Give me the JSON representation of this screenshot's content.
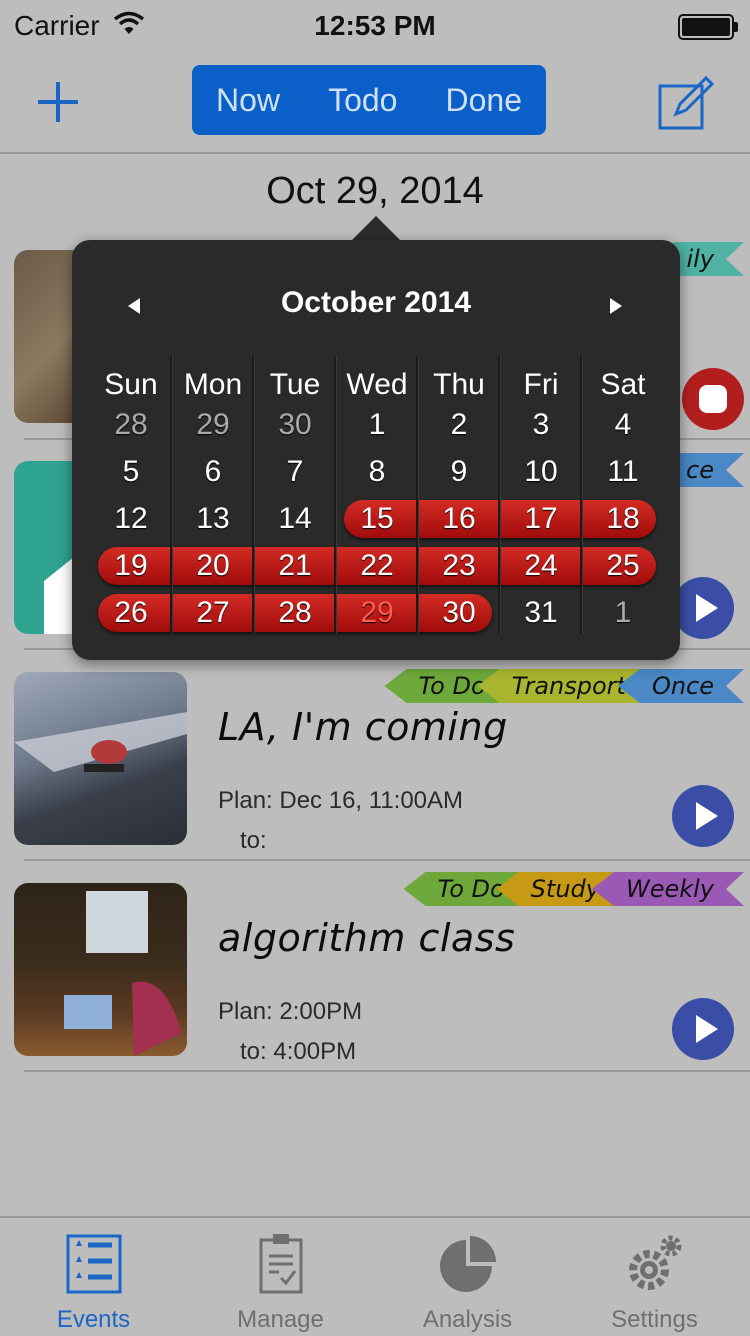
{
  "status_bar": {
    "carrier": "Carrier",
    "time": "12:53 PM"
  },
  "nav": {
    "segments": [
      "Now",
      "Todo",
      "Done"
    ],
    "accent": "#0a5fc8"
  },
  "date_heading": "Oct 29, 2014",
  "calendar": {
    "title": "October 2014",
    "weekdays": [
      "Sun",
      "Mon",
      "Tue",
      "Wed",
      "Thu",
      "Fri",
      "Sat"
    ],
    "weeks": [
      [
        "28",
        "29",
        "30",
        "1",
        "2",
        "3",
        "4"
      ],
      [
        "5",
        "6",
        "7",
        "8",
        "9",
        "10",
        "11"
      ],
      [
        "12",
        "13",
        "14",
        "15",
        "16",
        "17",
        "18"
      ],
      [
        "19",
        "20",
        "21",
        "22",
        "23",
        "24",
        "25"
      ],
      [
        "26",
        "27",
        "28",
        "29",
        "30",
        "31",
        "1"
      ]
    ],
    "today": "29",
    "highlight_color": "#c01a14"
  },
  "events": [
    {
      "title": "",
      "tags": [
        {
          "label": "ily",
          "color": "#4fb2a3"
        }
      ],
      "status": "stop"
    },
    {
      "title": "",
      "tags": [
        {
          "label": "ce",
          "color": "#4a88c6"
        }
      ],
      "status": "play"
    },
    {
      "title": "LA, I'm coming",
      "plan": "Plan: Dec 16, 11:00AM",
      "to": "to:",
      "tags": [
        {
          "label": "To Do",
          "color": "#6ea83a"
        },
        {
          "label": "Transport",
          "color": "#a9b52f"
        },
        {
          "label": "Once",
          "color": "#4a88c6"
        }
      ],
      "status": "play"
    },
    {
      "title": "algorithm class",
      "plan": "Plan: 2:00PM",
      "to": "to: 4:00PM",
      "tags": [
        {
          "label": "To Do",
          "color": "#6ea83a"
        },
        {
          "label": "Study",
          "color": "#c69a14"
        },
        {
          "label": "Weekly",
          "color": "#9b59b6"
        }
      ],
      "status": "play"
    }
  ],
  "tab_bar": {
    "items": [
      {
        "label": "Events",
        "icon": "events-list-icon",
        "active": true
      },
      {
        "label": "Manage",
        "icon": "clipboard-icon",
        "active": false
      },
      {
        "label": "Analysis",
        "icon": "pie-chart-icon",
        "active": false
      },
      {
        "label": "Settings",
        "icon": "gears-icon",
        "active": false
      }
    ],
    "active_color": "#1a66c6"
  }
}
